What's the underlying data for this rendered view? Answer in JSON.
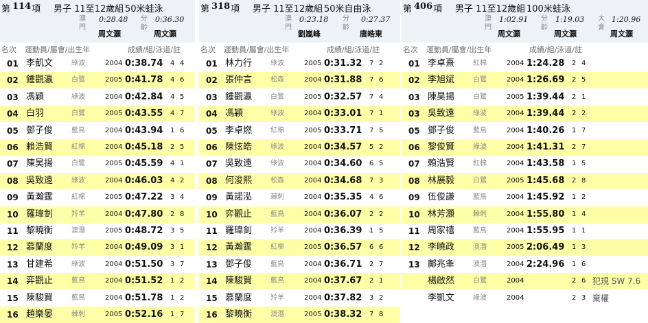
{
  "panels": [
    {
      "di": "第",
      "number": "114",
      "xiang": "項",
      "group": "男子 11至12歲組",
      "event": "50米蛙泳",
      "records": [
        {
          "label": "澳門",
          "time": "0:28.48",
          "holder": "周文灝"
        },
        {
          "label": "分齡",
          "time": "0:36.30",
          "holder": "周文灝"
        }
      ],
      "columns": {
        "rank": "名次",
        "athlete": "運動員/屬會/出生年",
        "result": "成績/組/泳道/註"
      },
      "rows": [
        {
          "rank": "01",
          "name": "李凱文",
          "club": "綠波",
          "year": "2004",
          "time": "0:38.74",
          "heat": "4",
          "lane": "4"
        },
        {
          "rank": "02",
          "name": "鍾觀瀛",
          "club": "白鷺",
          "year": "2005",
          "time": "0:41.78",
          "heat": "4",
          "lane": "6"
        },
        {
          "rank": "03",
          "name": "馮穎",
          "club": "綠波",
          "year": "2004",
          "time": "0:42.84",
          "heat": "4",
          "lane": "5"
        },
        {
          "rank": "04",
          "name": "白羽",
          "club": "白鷺",
          "year": "2005",
          "time": "0:43.55",
          "heat": "4",
          "lane": "7"
        },
        {
          "rank": "05",
          "name": "鄧子俊",
          "club": "藍鳥",
          "year": "2004",
          "time": "0:43.94",
          "heat": "1",
          "lane": "6"
        },
        {
          "rank": "06",
          "name": "賴浩賢",
          "club": "紅棉",
          "year": "2004",
          "time": "0:45.18",
          "heat": "2",
          "lane": "5"
        },
        {
          "rank": "07",
          "name": "陳昊揚",
          "club": "白鷺",
          "year": "2005",
          "time": "0:45.59",
          "heat": "4",
          "lane": "1"
        },
        {
          "rank": "08",
          "name": "吳致遠",
          "club": "綠波",
          "year": "2004",
          "time": "0:46.03",
          "heat": "4",
          "lane": "2"
        },
        {
          "rank": "09",
          "name": "黃瀚霆",
          "club": "紅棉",
          "year": "2005",
          "time": "0:47.22",
          "heat": "3",
          "lane": "4"
        },
        {
          "rank": "10",
          "name": "羅瑋釗",
          "club": "羚羊",
          "year": "2004",
          "time": "0:47.80",
          "heat": "2",
          "lane": "8"
        },
        {
          "rank": "11",
          "name": "黎曉衡",
          "club": "澳潛",
          "year": "2005",
          "time": "0:48.72",
          "heat": "3",
          "lane": "5"
        },
        {
          "rank": "12",
          "name": "慕蘭度",
          "club": "羚羊",
          "year": "2004",
          "time": "0:49.09",
          "heat": "3",
          "lane": "1"
        },
        {
          "rank": "13",
          "name": "甘建希",
          "club": "綠波",
          "year": "2004",
          "time": "0:51.50",
          "heat": "3",
          "lane": "7"
        },
        {
          "rank": "14",
          "name": "弈觀止",
          "club": "藍鳥",
          "year": "2004",
          "time": "0:51.52",
          "heat": "1",
          "lane": "2"
        },
        {
          "rank": "15",
          "name": "陳駿賢",
          "club": "藍鳥",
          "year": "2004",
          "time": "0:51.78",
          "heat": "1",
          "lane": "2"
        },
        {
          "rank": "16",
          "name": "趙樂晏",
          "club": "棘刺",
          "year": "2005",
          "time": "0:52.16",
          "heat": "1",
          "lane": "7"
        }
      ]
    },
    {
      "di": "第",
      "number": "318",
      "xiang": "項",
      "group": "男子 11至12歲組",
      "event": "50米自由泳",
      "records": [
        {
          "label": "澳門",
          "time": "0:23.18",
          "holder": "劉嵐峰"
        },
        {
          "label": "分齡",
          "time": "0:27.37",
          "holder": "唐皓東"
        }
      ],
      "columns": {
        "rank": "名次",
        "athlete": "運動員/屬會/出生年",
        "result": "成績/組/泳道/註"
      },
      "rows": [
        {
          "rank": "01",
          "name": "林力行",
          "club": "綠波",
          "year": "2005",
          "time": "0:31.32",
          "heat": "7",
          "lane": "2"
        },
        {
          "rank": "02",
          "name": "張仲言",
          "club": "松森",
          "year": "2004",
          "time": "0:31.88",
          "heat": "7",
          "lane": "6"
        },
        {
          "rank": "03",
          "name": "鍾觀瀛",
          "club": "白鷺",
          "year": "2005",
          "time": "0:32.57",
          "heat": "7",
          "lane": "4"
        },
        {
          "rank": "04",
          "name": "馮穎",
          "club": "綠波",
          "year": "2004",
          "time": "0:33.01",
          "heat": "7",
          "lane": "1"
        },
        {
          "rank": "05",
          "name": "李卓燃",
          "club": "紅棉",
          "year": "2005",
          "time": "0:33.71",
          "heat": "7",
          "lane": "5"
        },
        {
          "rank": "06",
          "name": "陳炫皓",
          "club": "綠波",
          "year": "2004",
          "time": "0:34.57",
          "heat": "5",
          "lane": "2"
        },
        {
          "rank": "07",
          "name": "吳致遠",
          "club": "綠波",
          "year": "2004",
          "time": "0:34.60",
          "heat": "6",
          "lane": "5"
        },
        {
          "rank": "08",
          "name": "何浚熙",
          "club": "松森",
          "year": "2004",
          "time": "0:34.68",
          "heat": "7",
          "lane": "3"
        },
        {
          "rank": "09",
          "name": "黃諾泓",
          "club": "棘刺",
          "year": "2004",
          "time": "0:35.35",
          "heat": "4",
          "lane": "6"
        },
        {
          "rank": "10",
          "name": "弈觀止",
          "club": "藍鳥",
          "year": "2004",
          "time": "0:36.07",
          "heat": "2",
          "lane": "2"
        },
        {
          "rank": "11",
          "name": "羅瑋釗",
          "club": "羚羊",
          "year": "2004",
          "time": "0:36.39",
          "heat": "1",
          "lane": "5"
        },
        {
          "rank": "12",
          "name": "黃瀚霆",
          "club": "紅棉",
          "year": "2005",
          "time": "0:36.57",
          "heat": "6",
          "lane": "6"
        },
        {
          "rank": "13",
          "name": "鄧子俊",
          "club": "藍鳥",
          "year": "2004",
          "time": "0:36.71",
          "heat": "2",
          "lane": "7"
        },
        {
          "rank": "14",
          "name": "陳駿賢",
          "club": "藍鳥",
          "year": "2004",
          "time": "0:37.67",
          "heat": "2",
          "lane": "1"
        },
        {
          "rank": "15",
          "name": "慕蘭度",
          "club": "羚羊",
          "year": "2004",
          "time": "0:37.82",
          "heat": "3",
          "lane": "2"
        },
        {
          "rank": "16",
          "name": "黎曉衡",
          "club": "澳潛",
          "year": "2005",
          "time": "0:38.32",
          "heat": "7",
          "lane": "8"
        }
      ]
    },
    {
      "di": "第",
      "number": "406",
      "xiang": "項",
      "group": "男子 11至12歲組",
      "event": "100米蛙泳",
      "records": [
        {
          "label": "澳門",
          "time": "1:02.91",
          "holder": "周文灝"
        },
        {
          "label": "分齡",
          "time": "1:19.03",
          "holder": "周文灝"
        },
        {
          "label": "大會",
          "time": "1:20.96",
          "holder": "周文灝"
        }
      ],
      "columns": {
        "rank": "名次",
        "athlete": "運動員/屬會/出生年",
        "result": "成績/組/泳道/註"
      },
      "rows": [
        {
          "rank": "01",
          "name": "李卓熹",
          "club": "紅棉",
          "year": "2004",
          "time": "1:24.28",
          "heat": "2",
          "lane": "4",
          "note": ""
        },
        {
          "rank": "02",
          "name": "李旭斌",
          "club": "白鷺",
          "year": "2004",
          "time": "1:26.69",
          "heat": "2",
          "lane": "5",
          "note": ""
        },
        {
          "rank": "03",
          "name": "陳昊揚",
          "club": "白鷺",
          "year": "2005",
          "time": "1:39.44",
          "heat": "2",
          "lane": "1",
          "note": ""
        },
        {
          "rank": "03",
          "name": "吳致遠",
          "club": "綠波",
          "year": "2004",
          "time": "1:39.44",
          "heat": "2",
          "lane": "2",
          "note": ""
        },
        {
          "rank": "05",
          "name": "鄧子俊",
          "club": "藍鳥",
          "year": "2004",
          "time": "1:40.26",
          "heat": "1",
          "lane": "7",
          "note": ""
        },
        {
          "rank": "06",
          "name": "黎俊賢",
          "club": "綠波",
          "year": "2004",
          "time": "1:41.31",
          "heat": "2",
          "lane": "7",
          "note": ""
        },
        {
          "rank": "07",
          "name": "賴浩賢",
          "club": "紅棉",
          "year": "2004",
          "time": "1:43.58",
          "heat": "1",
          "lane": "5",
          "note": ""
        },
        {
          "rank": "08",
          "name": "林展毅",
          "club": "白鷺",
          "year": "2005",
          "time": "1:45.68",
          "heat": "2",
          "lane": "8",
          "note": ""
        },
        {
          "rank": "09",
          "name": "伍俊謙",
          "club": "藍鳥",
          "year": "2004",
          "time": "1:45.92",
          "heat": "1",
          "lane": "2",
          "note": ""
        },
        {
          "rank": "10",
          "name": "林芳灝",
          "club": "棘刺",
          "year": "2004",
          "time": "1:55.80",
          "heat": "1",
          "lane": "4",
          "note": ""
        },
        {
          "rank": "11",
          "name": "周家禧",
          "club": "藍鳥",
          "year": "2004",
          "time": "1:55.95",
          "heat": "1",
          "lane": "1",
          "note": ""
        },
        {
          "rank": "12",
          "name": "李曉政",
          "club": "澳潛",
          "year": "2005",
          "time": "2:06.49",
          "heat": "1",
          "lane": "3",
          "note": ""
        },
        {
          "rank": "13",
          "name": "鄺兆夆",
          "club": "澳潛",
          "year": "2004",
          "time": "2:24.96",
          "heat": "1",
          "lane": "6",
          "note": ""
        },
        {
          "rank": "",
          "name": "楊啟然",
          "club": "白鷺",
          "year": "2004",
          "time": "",
          "heat": "2",
          "lane": "6",
          "note": "犯規 SW 7.6"
        },
        {
          "rank": "",
          "name": "李凱文",
          "club": "綠波",
          "year": "2004",
          "time": "",
          "heat": "2",
          "lane": "3",
          "note": "棄權"
        }
      ]
    }
  ]
}
